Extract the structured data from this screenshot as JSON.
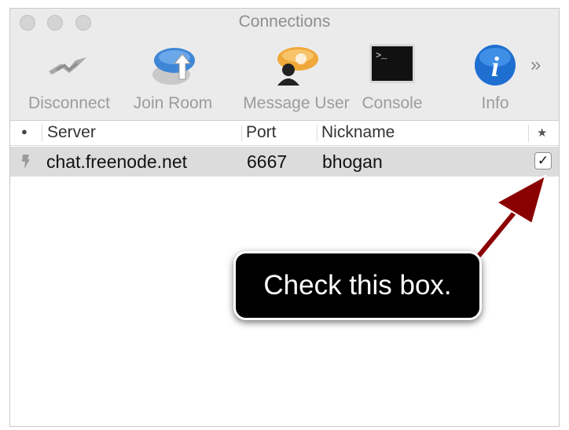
{
  "window": {
    "title": "Connections"
  },
  "toolbar": {
    "items": [
      {
        "label": "Disconnect",
        "icon": "disconnect-icon"
      },
      {
        "label": "Join Room",
        "icon": "chat-bubble-arrow-icon"
      },
      {
        "label": "Message User",
        "icon": "user-bubble-icon"
      },
      {
        "label": "Console",
        "icon": "terminal-icon"
      },
      {
        "label": "Info",
        "icon": "info-icon"
      }
    ],
    "overflow": "»",
    "console_prompt": ">_",
    "info_glyph": "i"
  },
  "table": {
    "columns": {
      "status": "●",
      "server": "Server",
      "port": "Port",
      "nickname": "Nickname",
      "favorite": "★"
    },
    "rows": [
      {
        "server": "chat.freenode.net",
        "port": "6667",
        "nickname": "bhogan",
        "auto_connect": "✓",
        "status_icon": "plug-icon"
      }
    ]
  },
  "annotation": {
    "text": "Check this box.",
    "arrow_color": "#8b0000"
  }
}
